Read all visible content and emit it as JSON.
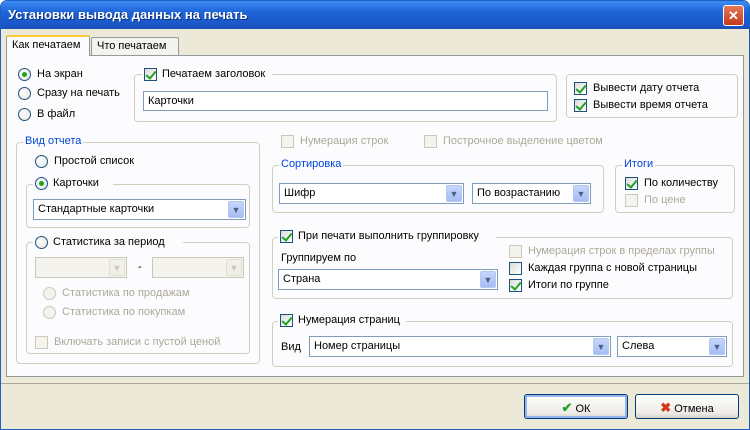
{
  "window": {
    "title": "Установки вывода данных на печать",
    "close_glyph": "✕"
  },
  "tabs": [
    "Как печатаем",
    "Что печатаем"
  ],
  "output": {
    "options": [
      "На экран",
      "Сразу на печать",
      "В файл"
    ],
    "selected": 0
  },
  "header": {
    "checkbox_label": "Печатаем заголовок",
    "checked": true,
    "value": "Карточки"
  },
  "report_meta": {
    "date_label": "Вывести дату отчета",
    "date_checked": true,
    "time_label": "Вывести время отчета",
    "time_checked": true
  },
  "report_type": {
    "legend": "Вид отчета",
    "simple_list": "Простой список",
    "cards": "Карточки",
    "cards_combo": "Стандартные карточки",
    "period_stats": "Статистика за период",
    "dash": "-",
    "by_sales": "Статистика по продажам",
    "by_purchases": "Статистика по покупкам",
    "include_zero_price": "Включать записи с пустой ценой"
  },
  "row_numbering": "Нумерация строк",
  "color_rows": "Построчное выделение цветом",
  "sorting": {
    "legend": "Сортировка",
    "field": "Шифр",
    "order": "По возрастанию"
  },
  "totals": {
    "legend": "Итоги",
    "by_quantity": "По количеству",
    "by_quantity_checked": true,
    "by_price": "По цене",
    "by_price_checked": false
  },
  "grouping": {
    "checkbox_label": "При печати выполнить группировку",
    "checked": true,
    "group_by_label": "Группируем по",
    "group_by_value": "Страна",
    "numbering_within": "Нумерация строк в пределах группы",
    "each_new_page": "Каждая группа с новой страницы",
    "each_new_page_checked": false,
    "group_totals": "Итоги по группе",
    "group_totals_checked": true
  },
  "page_numbering": {
    "checkbox_label": "Нумерация страниц",
    "checked": true,
    "view_label": "Вид",
    "view_value": "Номер страницы",
    "position_value": "Слева"
  },
  "buttons": {
    "ok": "ОК",
    "cancel": "Отмена"
  },
  "icons": {
    "dropdown": "▼",
    "ok_icon": "✔",
    "cancel_icon": "✖"
  },
  "colors": {
    "title_bar": "#1e63d7",
    "group_legend": "#0046d5",
    "check_mark": "#21a121"
  }
}
